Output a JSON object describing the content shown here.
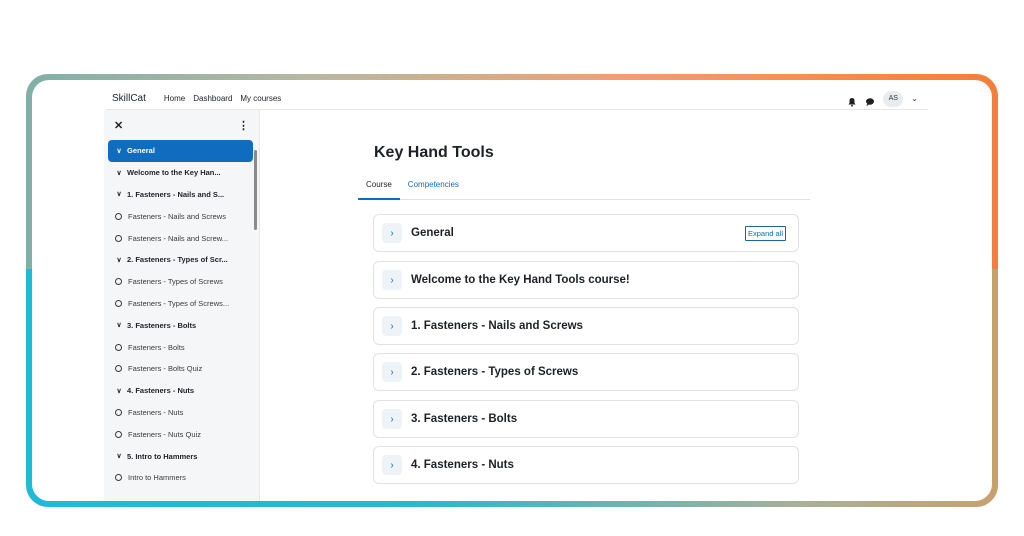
{
  "nav": {
    "brand": "SkillCat",
    "links": [
      "Home",
      "Dashboard",
      "My courses"
    ],
    "avatar_initials": "AS"
  },
  "sidebar": {
    "close_icon": "close-icon",
    "menu_icon": "kebab-menu-icon",
    "items": [
      {
        "label": "General",
        "type": "section",
        "active": true
      },
      {
        "label": "Welcome to the Key Han...",
        "type": "section"
      },
      {
        "label": "1. Fasteners - Nails and S...",
        "type": "section"
      },
      {
        "label": "Fasteners - Nails and Screws",
        "type": "activity"
      },
      {
        "label": "Fasteners - Nails and Screw...",
        "type": "activity"
      },
      {
        "label": "2. Fasteners - Types of Scr...",
        "type": "section"
      },
      {
        "label": "Fasteners - Types of Screws",
        "type": "activity"
      },
      {
        "label": "Fasteners - Types of Screws...",
        "type": "activity"
      },
      {
        "label": "3. Fasteners - Bolts",
        "type": "section"
      },
      {
        "label": "Fasteners - Bolts",
        "type": "activity"
      },
      {
        "label": "Fasteners - Bolts Quiz",
        "type": "activity"
      },
      {
        "label": "4. Fasteners - Nuts",
        "type": "section"
      },
      {
        "label": "Fasteners - Nuts",
        "type": "activity"
      },
      {
        "label": "Fasteners - Nuts Quiz",
        "type": "activity"
      },
      {
        "label": "5. Intro to Hammers",
        "type": "section"
      },
      {
        "label": "Intro to Hammers",
        "type": "activity"
      }
    ]
  },
  "main": {
    "title": "Key Hand Tools",
    "tabs": [
      {
        "label": "Course",
        "active": true
      },
      {
        "label": "Competencies",
        "active": false
      }
    ],
    "expand_all_label": "Expand all",
    "sections": [
      "General",
      "Welcome to the Key Hand Tools course!",
      "1. Fasteners - Nails and Screws",
      "2. Fasteners - Types of Screws",
      "3. Fasteners - Bolts",
      "4. Fasteners - Nuts"
    ]
  },
  "colors": {
    "primary": "#0f6cbf",
    "frame_top": "#f47e3a",
    "frame_bottom": "#1ebad8"
  }
}
